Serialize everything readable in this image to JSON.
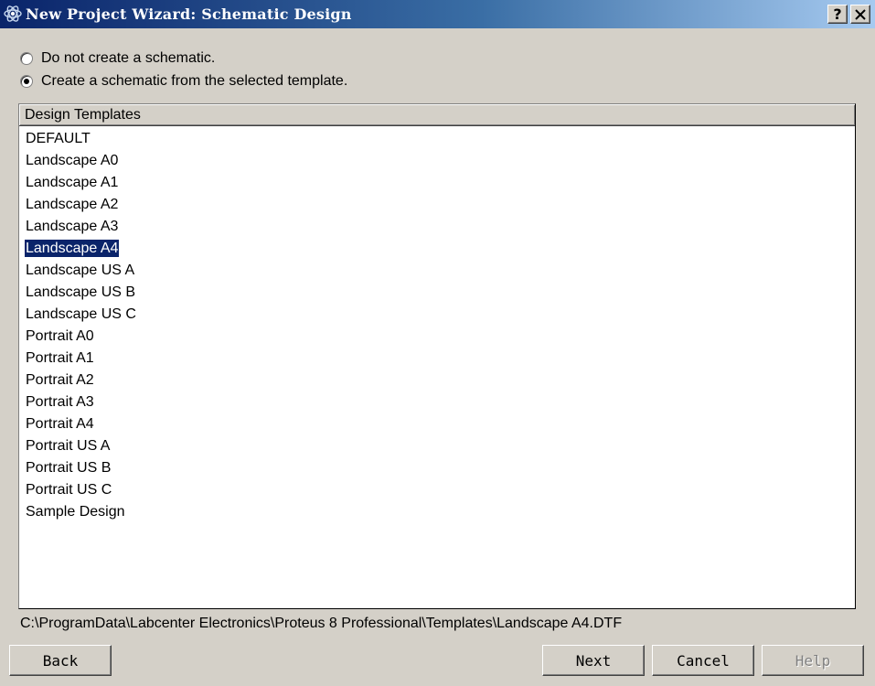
{
  "window": {
    "title": "New Project Wizard: Schematic Design",
    "help_button": "?",
    "close_button": "✕"
  },
  "options": [
    {
      "label": "Do not create a schematic.",
      "checked": false
    },
    {
      "label": "Create a schematic from the selected template.",
      "checked": true
    }
  ],
  "templates": {
    "header": "Design Templates",
    "items": [
      "DEFAULT",
      "Landscape A0",
      "Landscape A1",
      "Landscape A2",
      "Landscape A3",
      "Landscape A4",
      "Landscape US A",
      "Landscape US B",
      "Landscape US C",
      "Portrait A0",
      "Portrait A1",
      "Portrait A2",
      "Portrait A3",
      "Portrait A4",
      "Portrait US A",
      "Portrait US B",
      "Portrait US C",
      "Sample Design"
    ],
    "selected": "Landscape A4"
  },
  "path": "C:\\ProgramData\\Labcenter Electronics\\Proteus 8 Professional\\Templates\\Landscape A4.DTF",
  "buttons": {
    "back": "Back",
    "next": "Next",
    "cancel": "Cancel",
    "help": "Help"
  },
  "colors": {
    "dialog_bg": "#d4d0c8",
    "title_start": "#0a246a",
    "title_end": "#a6caf0",
    "selection": "#0a246a"
  }
}
